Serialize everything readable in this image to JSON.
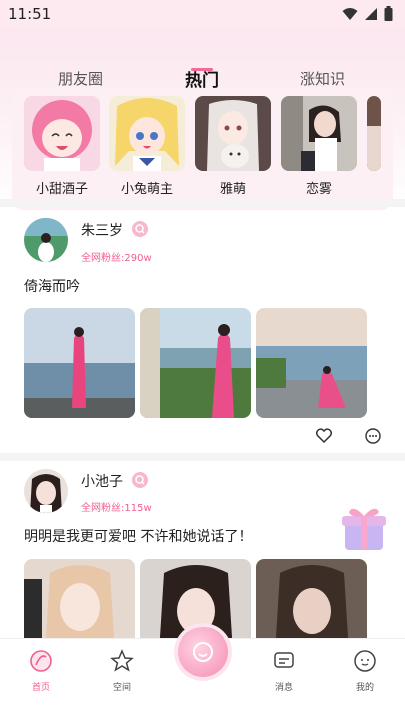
{
  "status_bar": {
    "time": "11:51",
    "icons": [
      "wifi-icon",
      "signal-icon",
      "battery-icon"
    ]
  },
  "tabs": [
    {
      "label": "朋友圈",
      "active": false
    },
    {
      "label": "热门",
      "active": true
    },
    {
      "label": "涨知识",
      "active": false
    }
  ],
  "avatars": [
    {
      "label": "小甜酒子"
    },
    {
      "label": "小兔萌主"
    },
    {
      "label": "雅萌"
    },
    {
      "label": "恋雾"
    }
  ],
  "posts": [
    {
      "name": "朱三岁",
      "fans": "全网粉丝:290w",
      "text": "倚海而吟"
    },
    {
      "name": "小池子",
      "fans": "全网粉丝:115w",
      "text": "明明是我更可爱吧 不许和她说话了！"
    }
  ],
  "bottom_nav": [
    {
      "label": "首页",
      "icon": "home-icon",
      "active": true
    },
    {
      "label": "空间",
      "icon": "star-icon",
      "active": false
    },
    {
      "label": "",
      "icon": "center-face-icon",
      "active": false
    },
    {
      "label": "消息",
      "icon": "message-icon",
      "active": false
    },
    {
      "label": "我的",
      "icon": "profile-face-icon",
      "active": false
    }
  ],
  "colors": {
    "accent": "#f0608f",
    "tab_indicator": "#f36a9a",
    "header_bg": "#fbe7ef"
  }
}
